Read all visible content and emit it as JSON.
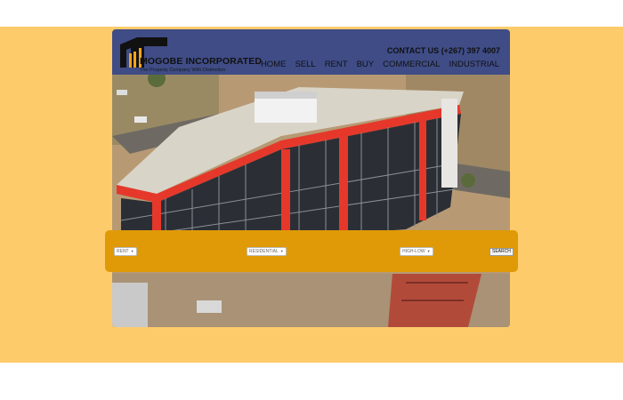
{
  "brand": {
    "name": "MOGOBE INCORPORATED",
    "tagline": "The Property Company With Distinction"
  },
  "header": {
    "contact": "CONTACT US (+267) 397 4007"
  },
  "nav": {
    "items": [
      "HOME",
      "SELL",
      "RENT",
      "BUY",
      "COMMERCIAL",
      "INDUSTRIAL"
    ]
  },
  "search": {
    "listing_type": "RENT",
    "property_type": "RESIDENTIAL",
    "sort": "HIGH-LOW",
    "button_label": "SEARCH"
  },
  "colors": {
    "background": "#fecb6b",
    "header": "#3f4c86",
    "search_bar": "#e09a07"
  },
  "icons": {
    "logo": "building-logo-icon",
    "dropdown": "chevron-down-icon"
  }
}
